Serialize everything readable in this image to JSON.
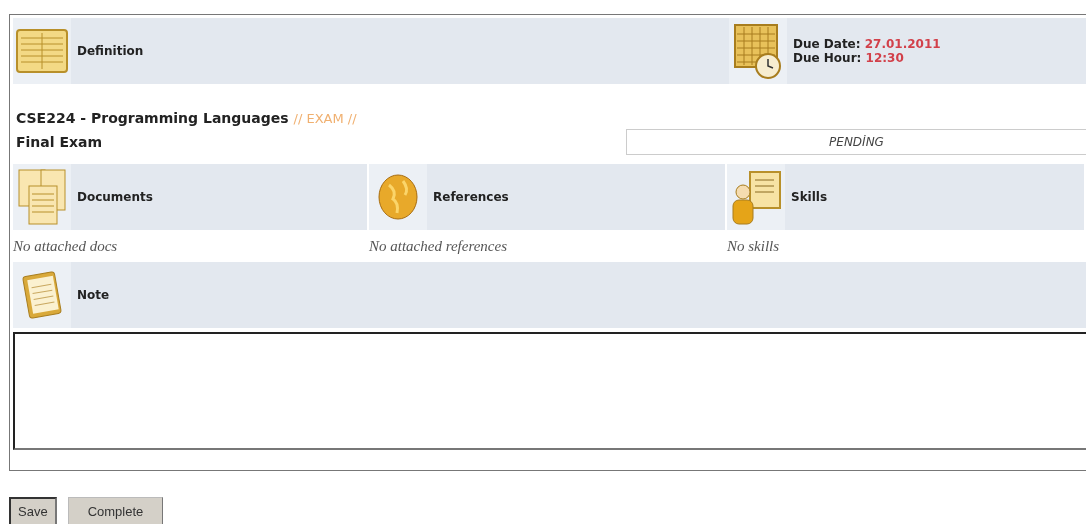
{
  "header": {
    "title": "Definition",
    "due_date_label": "Due Date:",
    "due_date": "27.01.2011",
    "due_hour_label": "Due Hour:",
    "due_hour": "12:30"
  },
  "course": {
    "name": "CSE224 - Programming Languages",
    "type": "// EXAM //",
    "title": "Final Exam",
    "status": "PENDİNG"
  },
  "sections": [
    {
      "kind": "documents",
      "title": "Documents",
      "empty_text": "No attached docs"
    },
    {
      "kind": "references",
      "title": "References",
      "empty_text": "No attached references"
    },
    {
      "kind": "skills",
      "title": "Skills",
      "empty_text": "No skills"
    }
  ],
  "note": {
    "title": "Note"
  },
  "buttons": [
    {
      "kind": "save",
      "label": "Save"
    },
    {
      "kind": "complete",
      "label": "Complete"
    }
  ]
}
